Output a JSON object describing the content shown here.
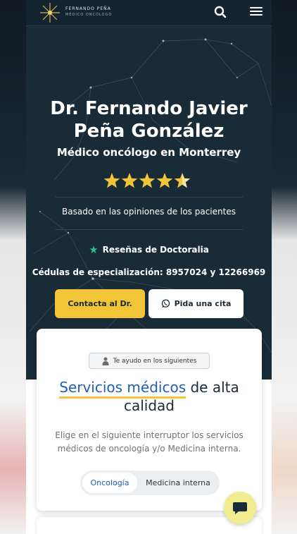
{
  "header": {
    "logo_name": "FERNANDO PEÑA",
    "logo_sub": "MÉDICO ONCÓLOGO",
    "search_icon": "search-icon",
    "menu_icon": "hamburger-menu-icon"
  },
  "hero": {
    "title": "Dr. Fernando Javier Peña González",
    "subtitle": "Médico oncólogo en Monterrey",
    "rating": 4.5,
    "rating_max": 5,
    "based_on": "Basado en las opiniones de los pacientes",
    "reviews_label": "Reseñas de Doctoralia",
    "cedulas": "Cédulas de especialización: 8957024 y 12266969",
    "contact_button": "Contacta al Dr.",
    "appointment_button": "Pida una cita"
  },
  "services": {
    "chip": "Te ayudo en los siguientes",
    "title_accent": "Servicios médicos",
    "title_rest": " de alta calidad",
    "description": "Elige en el siguiente interruptor los servicios médicos de oncología y/o Medicina interna.",
    "toggle_options": [
      "Oncología",
      "Medicina interna"
    ],
    "toggle_selected": "Oncología"
  },
  "colors": {
    "hero_bg": "#1a2b38",
    "accent_yellow": "#f2c437",
    "link_blue": "#1f5fb4",
    "doctoralia_green": "#2fbf8a",
    "chat_bg": "#f0ec8f"
  }
}
